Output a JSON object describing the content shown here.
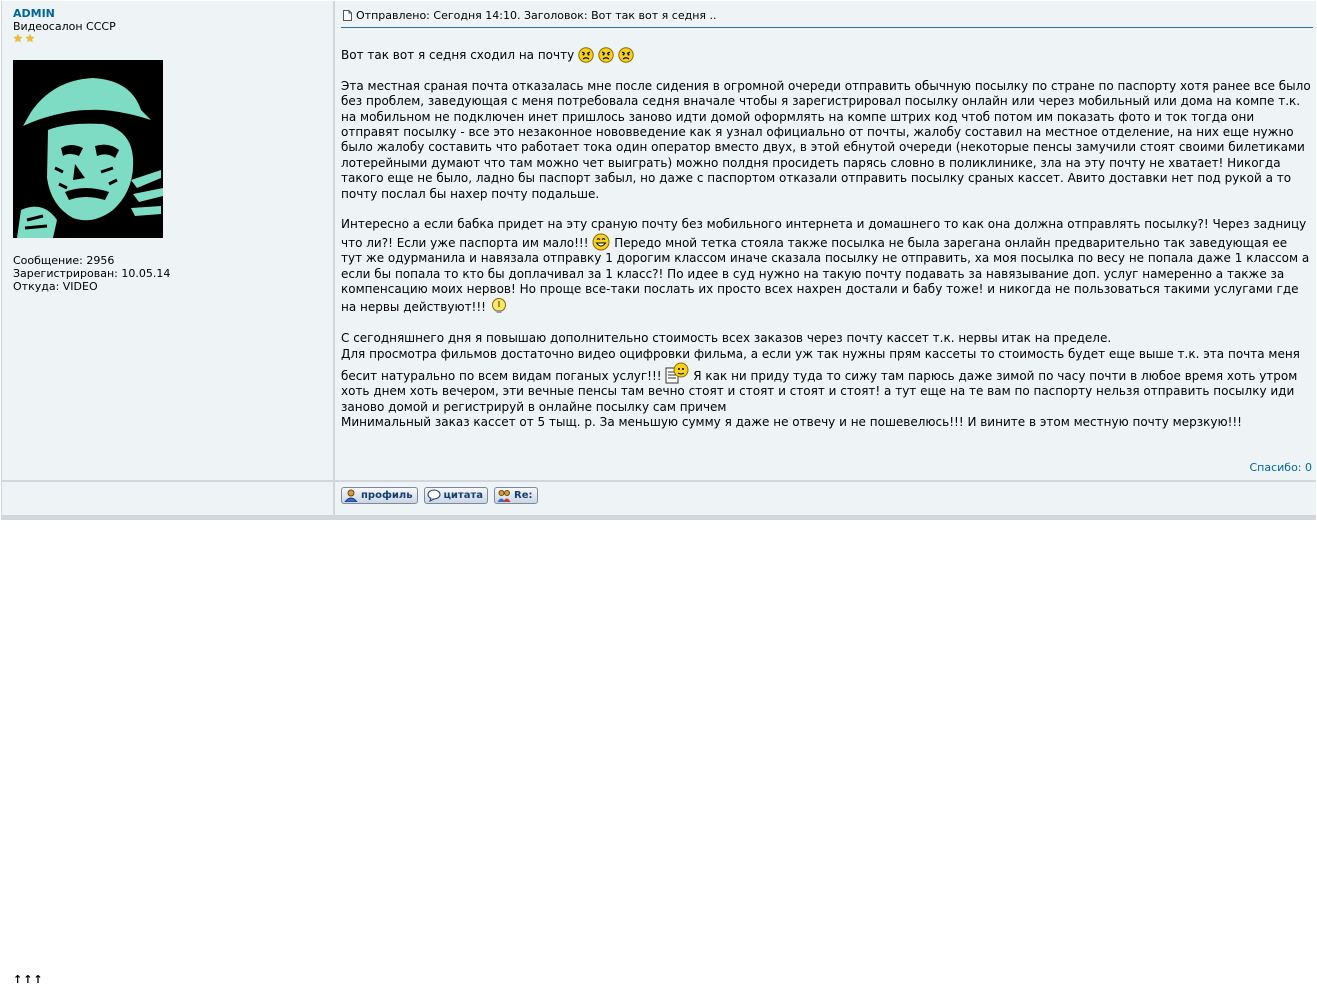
{
  "user": {
    "name": "ADMIN",
    "title": "Видеосалон СССР",
    "rank_stars": 2,
    "stats": [
      "Сообщение: 2956",
      "Зарегистрирован: 10.05.14",
      "Откуда: VIDEO"
    ]
  },
  "post": {
    "header": "Отправлено: Сегодня 14:10. Заголовок: Вот так вот я седня ..",
    "line1": "Вот так вот я седня сходил на почту",
    "para1": "Эта местная сраная почта отказалась мне после сидения в огромной очереди отправить обычную посылку по стране по паспорту хотя ранее все было без проблем, заведующая с меня потребовала седня вначале чтобы я зарегистрировал посылку онлайн или через мобильный или дома на компе т.к. на мобильном не подключен инет пришлось заново идти домой оформлять на компе штрих код чтоб потом им показать фото и ток тогда они отправят посылку - все это незаконное нововведение как я узнал официально от почты, жалобу составил на местное отделение, на них еще нужно было жалобу составить что работает тока один оператор вместо двух, в этой ебнутой очереди (некоторые пенсы замучили стоят своими билетиками лотерейными думают что там можно чет выиграть) можно полдня просидеть парясь словно в поликлинике, зла на эту почту не хватает! Никогда такого еще не было, ладно бы паспорт забыл, но даже с паспортом отказали отправить посылку сраных кассет. Авито доставки нет под рукой а то почту послал бы нахер почту подальше.",
    "para2a": "Интересно а если бабка придет на эту сраную почту без мобильного интернета и домашнего то как она должна отправлять посылку?! Через задницу что ли?! Если уже паспорта им мало!!!",
    "para2b": "Передо мной тетка стояла также посылка не была зарегана онлайн предварительно так заведующая ее тут же одурманила и навязала отправку 1 дорогим классом иначе сказала посылку не отправить, ха моя посылка по весу не попала даже 1 классом а если бы попала то кто бы доплачивал за 1 класс?! По идее в суд нужно на такую почту подавать за навязывание доп. услуг намеренно а также за компенсацию моих нервов! Но проще все-таки послать их просто всех нахрен достали и бабу тоже! и никогда не пользоваться такими услугами где на нервы действуют!!!",
    "para3a": "С сегодняшнего дня я повышаю дополнительно стоимость всех заказов через почту кассет т.к. нервы итак на пределе.",
    "para3b": "Для просмотра фильмов достаточно видео оцифровки фильма, а если уж так нужны прям кассеты то стоимость будет еще выше т.к. эта почта меня бесит натурально по всем видам поганых услуг!!!",
    "para3c": "Я как ни приду туда то сижу там парюсь даже зимой по часу почти в любое время хоть утром хоть днем хоть вечером, эти вечные пенсы там вечно стоят и стоят и стоят и стоят! а тут еще на те вам по паспорту нельзя отправить посылку иди заново домой и регистрируй в онлайне посылку сам причем",
    "para3d": "Минимальный заказ кассет от 5 тыщ. р. За меньшую сумму я даже не отвечу и не пошевелюсь!!! И вините в этом местную почту мерзкую!!!",
    "thanks": "Спасибо: 0"
  },
  "footer": {
    "back_to_top": "↑↑↑",
    "buttons": [
      {
        "label": "профиль"
      },
      {
        "label": "цитата"
      },
      {
        "label": "Re:"
      }
    ]
  },
  "colors": {
    "link": "#006699",
    "cell_bg": "#eef3f6",
    "border": "#d1d7dc"
  }
}
